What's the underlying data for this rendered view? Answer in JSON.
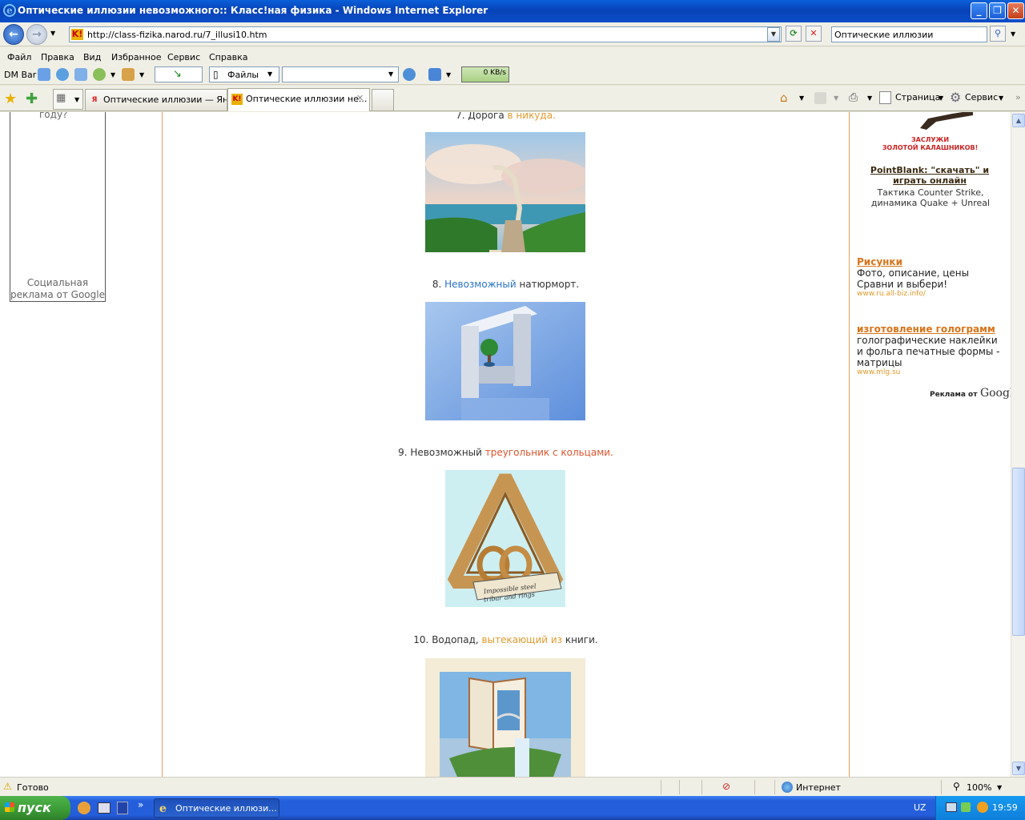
{
  "window": {
    "title": "Оптические иллюзии невозможного:: Класс!ная физика - Windows Internet Explorer"
  },
  "address": {
    "url": "http://class-fizika.narod.ru/7_illusi10.htm",
    "search_value": "Оптические иллюзии"
  },
  "menu": [
    "Файл",
    "Правка",
    "Вид",
    "Избранное",
    "Сервис",
    "Справка"
  ],
  "dmbar": {
    "label": "DM Bar",
    "files_label": "Файлы",
    "speed": "0 KB/s"
  },
  "tabs": [
    {
      "label": "Оптические иллюзии — Ян...",
      "active": false
    },
    {
      "label": "Оптические иллюзии не...",
      "active": true
    }
  ],
  "commandbar": {
    "page": "Страница",
    "tools": "Сервис"
  },
  "left_ad": {
    "top_fragment": "году?",
    "caption_line1": "Социальная",
    "caption_line2": "реклама от Google"
  },
  "items": [
    {
      "num": "7.",
      "parts": [
        "Дорога ",
        "в никуда."
      ]
    },
    {
      "num": "8.",
      "parts": [
        "Невозможный",
        " натюрморт."
      ]
    },
    {
      "num": "9.",
      "parts": [
        "Невозможный ",
        "треугольник с кольцами."
      ]
    },
    {
      "num": "10.",
      "parts": [
        "Водопад, ",
        "вытекающий из",
        " книги."
      ]
    }
  ],
  "triangle_caption": [
    "Impossible steel",
    "tribar and rings"
  ],
  "right_ads": {
    "banner_text_1": "ЗАСЛУЖИ",
    "banner_text_2": "ЗОЛОТОЙ КАЛАШНИКОВ!",
    "ad1_title": "PointBlank: \"скачать\" и играть онлайн",
    "ad1_text": "Тактика Counter Strike, динамика Quake + Unreal",
    "ad2_title": "Рисунки",
    "ad2_text": "Фото, описание, цены Сравни и выбери!",
    "ad2_url": "www.ru.all-biz.info/",
    "ad3_title": "изготовление голограмм",
    "ad3_text": "голографические наклейки и фольга печатные формы - матрицы",
    "ad3_url": "www.mlg.su",
    "google_label": "Реклама от",
    "google_brand": "Google"
  },
  "status": {
    "text": "Готово",
    "zone": "Интернет",
    "zoom": "100%"
  },
  "taskbar": {
    "start": "пуск",
    "window": "Оптические иллюзи...",
    "lang": "UZ",
    "time": "19:59"
  },
  "colors": {
    "accent_orange": "#e39a2d",
    "accent_blue": "#2a73c9",
    "accent_red": "#e0542e",
    "ad_title_orange": "#d9741a",
    "ad_url_green": "#e39a2d",
    "border_orange": "#e8a15a"
  }
}
